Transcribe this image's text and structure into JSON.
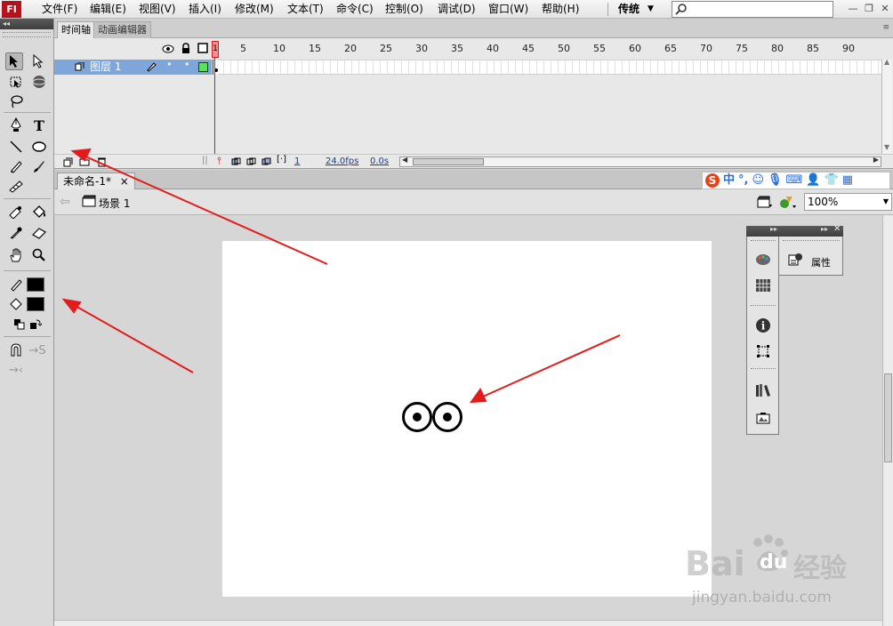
{
  "app": {
    "logo": "Fl"
  },
  "menu": [
    {
      "label": "文件(F)"
    },
    {
      "label": "编辑(E)"
    },
    {
      "label": "视图(V)"
    },
    {
      "label": "插入(I)"
    },
    {
      "label": "修改(M)"
    },
    {
      "label": "文本(T)"
    },
    {
      "label": "命令(C)"
    },
    {
      "label": "控制(O)"
    },
    {
      "label": "调试(D)"
    },
    {
      "label": "窗口(W)"
    },
    {
      "label": "帮助(H)"
    }
  ],
  "workspace": {
    "label": "传统"
  },
  "search": {
    "placeholder": "",
    "value": ""
  },
  "timeline": {
    "tabs": [
      {
        "label": "时间轴"
      },
      {
        "label": "动画编辑器"
      }
    ],
    "frame_numbers": [
      "1",
      "5",
      "10",
      "15",
      "20",
      "25",
      "30",
      "35",
      "40",
      "45",
      "50",
      "55",
      "60",
      "65",
      "70",
      "75",
      "80",
      "85",
      "90"
    ],
    "current_frame": "1",
    "layer": {
      "name": "图层 1"
    },
    "status": {
      "frame": "1",
      "fps": "24.0fps",
      "time": "0.0s"
    }
  },
  "document": {
    "tab_title": "未命名-1*",
    "tab_close": "×",
    "scene": "场景 1",
    "zoom": "100%"
  },
  "ime": {
    "logo": "S",
    "mode": "中",
    "punct": "°,"
  },
  "dock": {
    "properties_label": "属性"
  },
  "watermark": {
    "brand": "Bai",
    "brand_du": "du",
    "brand_cn": "经验",
    "url": "jingyan.baidu.com"
  },
  "colors": {
    "accent_red": "#e31b1b",
    "layer_highlight": "#7ea6da",
    "stage": "#ffffff",
    "logo": "#b5121b"
  }
}
